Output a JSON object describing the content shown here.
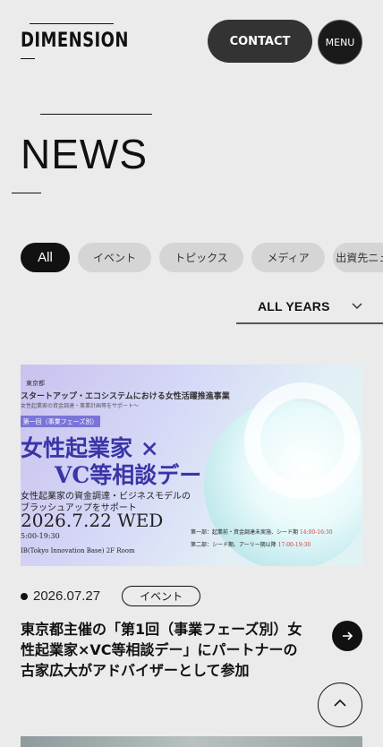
{
  "header": {
    "logo": "DIMENSION",
    "contact_label": "CONTACT",
    "menu_label": "MENU"
  },
  "page_title": "NEWS",
  "filters": {
    "items": [
      "All",
      "イベント",
      "トピックス",
      "メディア",
      "出資先ニュース"
    ],
    "selected_index": 0
  },
  "year_select": {
    "value": "ALL YEARS"
  },
  "article": {
    "image": {
      "org": "東京都",
      "project": "スタートアップ・エコシステムにおける女性活躍推進事業",
      "sub": "女性起業家の資金調達・事業計画等をサポート〜",
      "badge": "第一回（事業フェーズ別）",
      "headline_1": "女性起業家 ×",
      "headline_2": "VC等相談デー",
      "desc_1": "女性起業家の資金調達・ビジネスモデルの",
      "desc_2": "ブラッシュアップをサポート",
      "date": "2026.7.22 WED",
      "time": "5:00-19:30",
      "place": "IB(Tokyo Innovation Base) 2F Room",
      "session_1_label": "第一部：起業前・資金調達未実施、シード期",
      "session_1_time": "14:00-16:30",
      "session_2_label": "第二部：シード期、アーリー期以降",
      "session_2_time": "17:00-19:30"
    },
    "date": "2026.07.27",
    "tag": "イベント",
    "title": "東京都主催の「第1回（事業フェーズ別）女性起業家×VC等相談デー」にパートナーの古家広大がアドバイザーとして参加"
  },
  "icons": {
    "arrow": "arrow-right-icon",
    "chevron": "chevron-down-icon",
    "top": "chevron-up-icon"
  }
}
